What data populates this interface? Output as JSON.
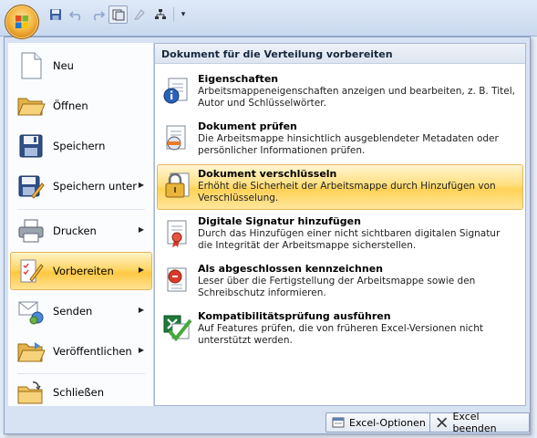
{
  "qat": {
    "items": [
      "save-icon",
      "undo-icon",
      "redo-icon",
      "print-preview-icon",
      "spelling-icon",
      "organizer-icon"
    ],
    "more": "▾"
  },
  "left_menu": {
    "items": [
      {
        "label": "Neu",
        "icon": "new-document-icon"
      },
      {
        "label": "Öffnen",
        "icon": "open-folder-icon"
      },
      {
        "label": "Speichern",
        "icon": "save-icon"
      },
      {
        "label": "Speichern unter",
        "icon": "save-as-icon",
        "arrow": "▶"
      },
      {
        "label": "Drucken",
        "icon": "printer-icon",
        "arrow": "▶"
      },
      {
        "label": "Vorbereiten",
        "icon": "prepare-icon",
        "arrow": "▶"
      },
      {
        "label": "Senden",
        "icon": "send-icon",
        "arrow": "▶"
      },
      {
        "label": "Veröffentlichen",
        "icon": "publish-icon",
        "arrow": "▶"
      },
      {
        "label": "Schließen",
        "icon": "close-folder-icon"
      }
    ]
  },
  "submenu": {
    "header": "Dokument für die Verteilung vorbereiten",
    "items": [
      {
        "title": "Eigenschaften",
        "desc": "Arbeitsmappeneigenschaften anzeigen und bearbeiten, z. B. Titel, Autor und Schlüsselwörter.",
        "icon": "properties-icon"
      },
      {
        "title": "Dokument prüfen",
        "desc": "Die Arbeitsmappe hinsichtlich ausgeblendeter Metadaten oder persönlicher Informationen prüfen.",
        "icon": "inspect-document-icon"
      },
      {
        "title": "Dokument verschlüsseln",
        "desc": "Erhöht die Sicherheit der Arbeitsmappe durch Hinzufügen von Verschlüsselung.",
        "icon": "encrypt-lock-icon"
      },
      {
        "title": "Digitale Signatur hinzufügen",
        "desc": "Durch das Hinzufügen einer nicht sichtbaren digitalen Signatur die Integrität der Arbeitsmappe sicherstellen.",
        "icon": "digital-signature-icon"
      },
      {
        "title": "Als abgeschlossen kennzeichnen",
        "desc": "Leser über die Fertigstellung der Arbeitsmappe sowie den Schreibschutz informieren.",
        "icon": "mark-final-icon"
      },
      {
        "title": "Kompatibilitätsprüfung ausführen",
        "desc": "Auf Features prüfen, die von früheren Excel-Versionen nicht unterstützt werden.",
        "icon": "compatibility-check-icon"
      }
    ]
  },
  "footer": {
    "options_label": "Excel-Optionen",
    "exit_label": "Excel beenden"
  }
}
